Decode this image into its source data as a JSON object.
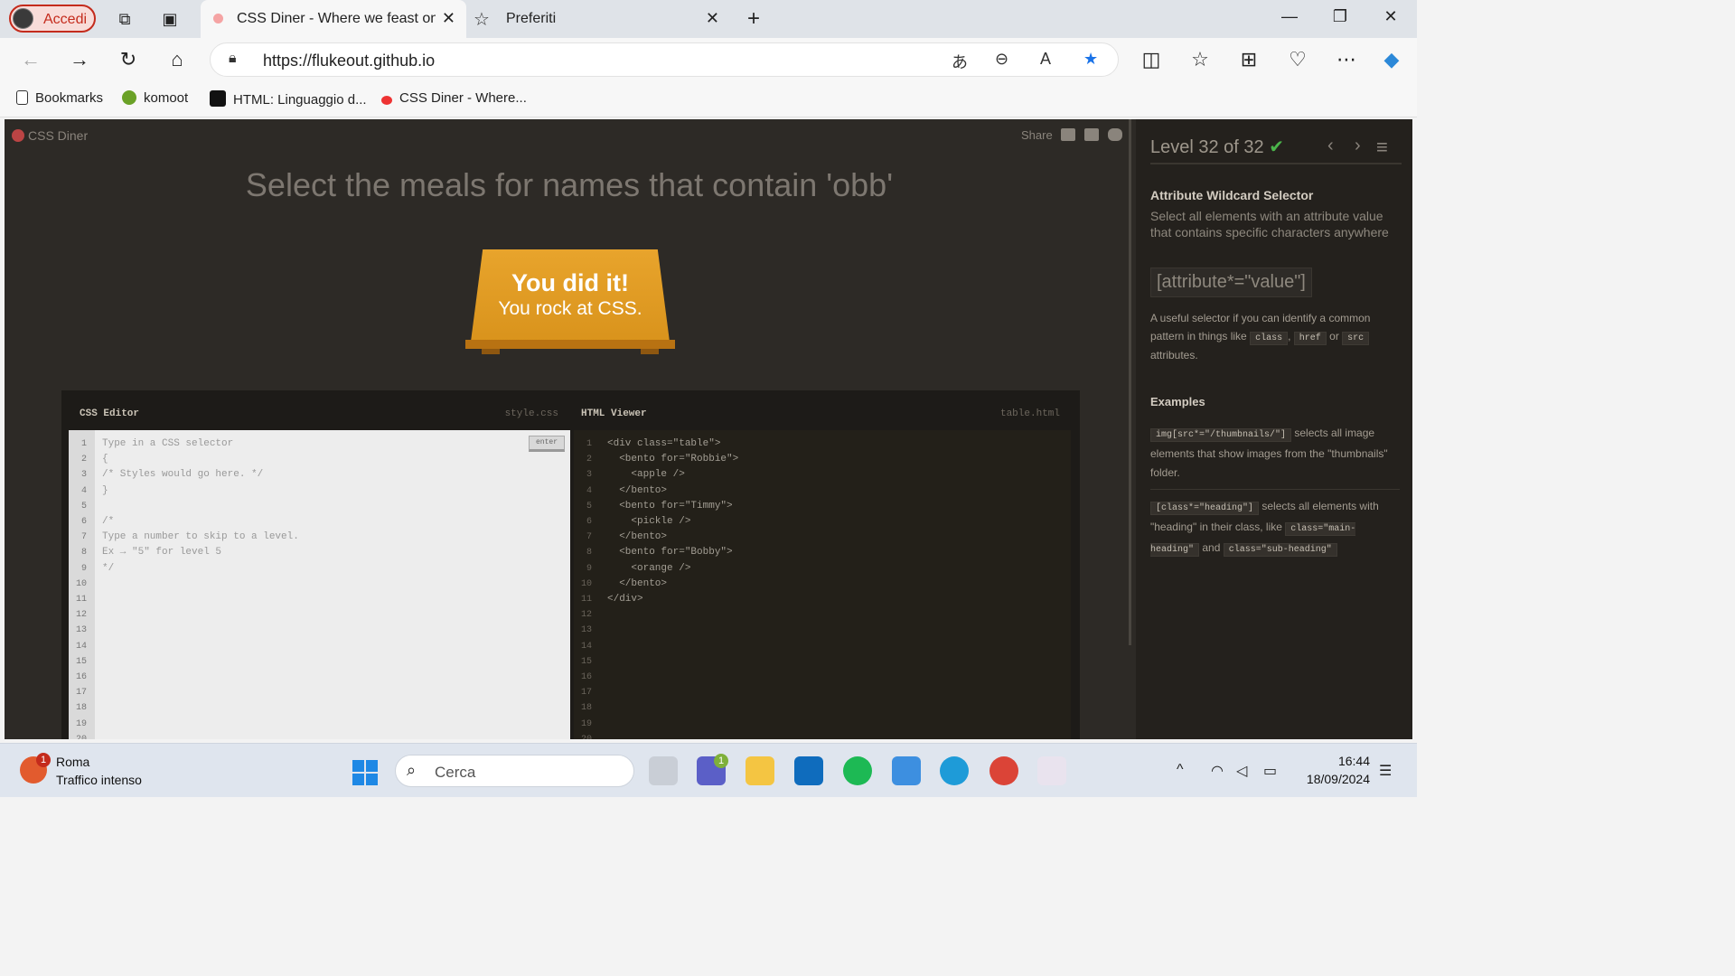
{
  "browser": {
    "profile_label": "Accedi",
    "active_tab_title": "CSS Diner - Where we feast on CSS",
    "second_tab_title": "Preferiti",
    "url": "https://flukeout.github.io",
    "bookmarks": [
      {
        "label": "Bookmarks",
        "icon": "file-icon"
      },
      {
        "label": "komoot",
        "icon": "komoot-icon"
      },
      {
        "label": "HTML: Linguaggio d...",
        "icon": "mdn-icon"
      },
      {
        "label": "CSS Diner - Where...",
        "icon": "css-diner-icon"
      }
    ]
  },
  "page": {
    "logo": "CSS Diner",
    "share": "Share",
    "order": "Select the meals for names that contain 'obb'",
    "done_line1": "You did it!",
    "done_line2": "You rock at CSS.",
    "css_editor": {
      "title": "CSS Editor",
      "filename": "style.css",
      "enter": "enter",
      "lines": "Type in a CSS selector\n{\n/* Styles would go here. */\n}\n\n/*\nType a number to skip to a level.\nEx → \"5\" for level 5\n*/",
      "line_numbers": "1\n2\n3\n4\n5\n6\n7\n8\n9\n10\n11\n12\n13\n14\n15\n16\n17\n18\n19\n20"
    },
    "html_viewer": {
      "title": "HTML Viewer",
      "filename": "table.html",
      "lines": "<div class=\"table\">\n  <bento for=\"Robbie\">\n    <apple />\n  </bento>\n  <bento for=\"Timmy\">\n    <pickle />\n  </bento>\n  <bento for=\"Bobby\">\n    <orange />\n  </bento>\n</div>",
      "line_numbers": "1\n2\n3\n4\n5\n6\n7\n8\n9\n10\n11\n12\n13\n14\n15\n16\n17\n18\n19\n20"
    }
  },
  "sidebar": {
    "level": "Level 32 of 32",
    "check": "✔",
    "title": "Attribute Wildcard Selector",
    "description": "Select all elements with an attribute value that contains specific characters anywhere",
    "syntax": "[attribute*=\"value\"]",
    "hint_pre": "A useful selector if you can identify a common pattern in things like",
    "hint_tag1": "class",
    "hint_sep": ",",
    "hint_tag2": "href",
    "hint_or": "or",
    "hint_tag3": "src",
    "hint_post": "attributes.",
    "examples_heading": "Examples",
    "ex1_code": "img[src*=\"/thumbnails/\"]",
    "ex1_text": "selects all image elements that show images from the \"thumbnails\" folder.",
    "ex2_code": "[class*=\"heading\"]",
    "ex2_text1": "selects all elements with \"heading\" in their class, like",
    "ex2_code2": "class=\"main-heading\"",
    "ex2_and": "and",
    "ex2_code3": "class=\"sub-heading\""
  },
  "taskbar": {
    "weather_badge": "1",
    "weather_city": "Roma",
    "weather_status": "Traffico intenso",
    "search_placeholder": "Cerca",
    "teams_badge": "1",
    "time": "16:44",
    "date": "18/09/2024"
  }
}
